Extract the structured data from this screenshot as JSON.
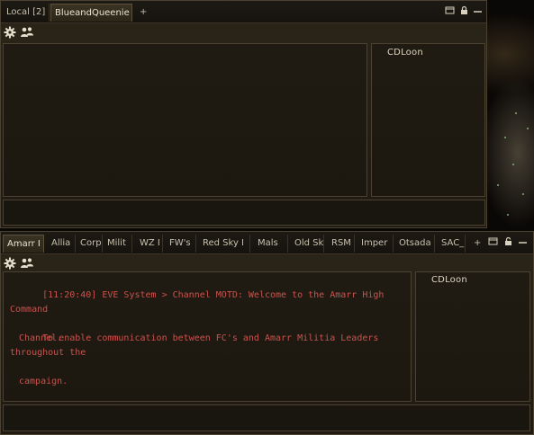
{
  "local_window": {
    "tabs": [
      {
        "label": "Local [2]",
        "active": false
      },
      {
        "label": "BlueandQueenie",
        "active": true
      },
      {
        "label": "+",
        "active": false
      }
    ],
    "controls": [
      "display-icon",
      "lock-icon",
      "minimize-icon"
    ],
    "members": [
      "CDLoon"
    ]
  },
  "chat_window": {
    "tabs": [
      {
        "label": "Amarr I",
        "active": true
      },
      {
        "label": "Allia"
      },
      {
        "label": "Corp"
      },
      {
        "label": "Milit"
      },
      {
        "label": "WZ I"
      },
      {
        "label": "FW's"
      },
      {
        "label": "Red Sky I"
      },
      {
        "label": "Mals"
      },
      {
        "label": "Old Sk"
      },
      {
        "label": "RSM"
      },
      {
        "label": "Imper"
      },
      {
        "label": "Otsada"
      },
      {
        "label": "SAC_"
      },
      {
        "label": "+"
      }
    ],
    "controls": [
      "display-icon",
      "lock-icon",
      "minimize-icon"
    ],
    "messages": [
      {
        "line1": "[11:20:40] EVE System > Channel MOTD: Welcome to the Amarr High Command",
        "line2": "Channel."
      },
      {
        "line1": "To enable communication between FC's and Amarr Militia Leaders throughout the",
        "line2": "campaign."
      }
    ],
    "members": [
      "CDLoon"
    ]
  },
  "colors": {
    "motd_text": "#c9534f",
    "window_bg": "#241f15",
    "border": "#4b4232"
  }
}
